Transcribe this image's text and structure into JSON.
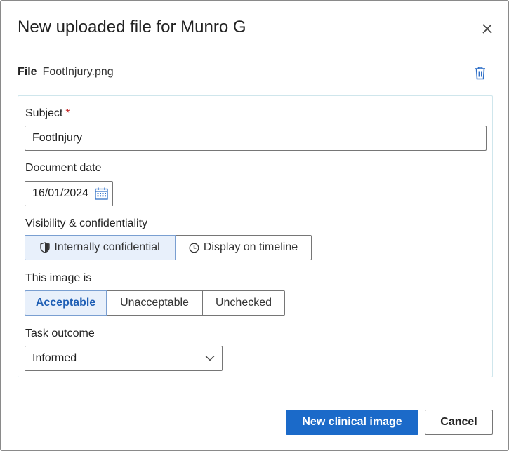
{
  "dialog": {
    "title": "New uploaded file for Munro G"
  },
  "file": {
    "label": "File",
    "name": "FootInjury.png"
  },
  "form": {
    "subject": {
      "label": "Subject",
      "required_mark": "*",
      "value": "FootInjury"
    },
    "document_date": {
      "label": "Document date",
      "value": "16/01/2024"
    },
    "visibility": {
      "label": "Visibility & confidentiality",
      "options": [
        {
          "label": "Internally confidential",
          "icon": "shield-icon",
          "selected": true
        },
        {
          "label": "Display on timeline",
          "icon": "clock-icon",
          "selected": false
        }
      ]
    },
    "image_status": {
      "label": "This image is",
      "options": [
        {
          "label": "Acceptable",
          "selected": true
        },
        {
          "label": "Unacceptable",
          "selected": false
        },
        {
          "label": "Unchecked",
          "selected": false
        }
      ]
    },
    "task_outcome": {
      "label": "Task outcome",
      "value": "Informed"
    }
  },
  "footer": {
    "primary_label": "New clinical image",
    "cancel_label": "Cancel"
  },
  "colors": {
    "primary": "#1b6ac9",
    "selected_bg": "#e8f0fb",
    "required": "#c62828"
  }
}
